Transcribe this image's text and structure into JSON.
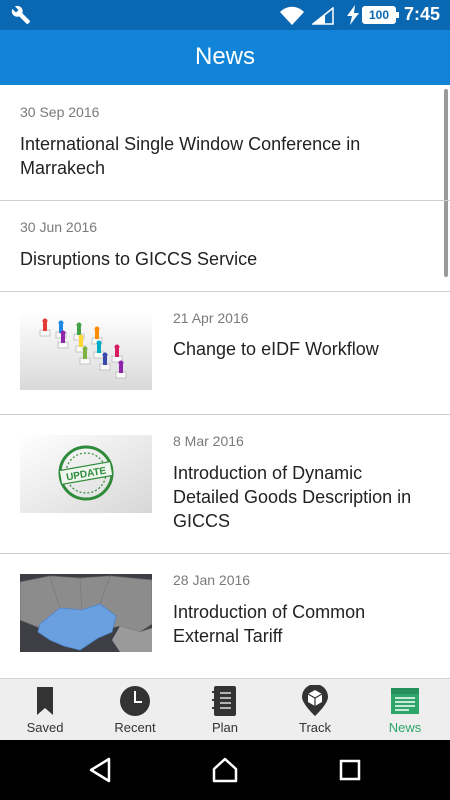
{
  "status_bar": {
    "battery_level": "100",
    "time": "7:45"
  },
  "header": {
    "title": "News"
  },
  "news_items": [
    {
      "date": "30 Sep 2016",
      "title": "International Single Window Conference in Marrakech"
    },
    {
      "date": "30 Jun 2016",
      "title": "Disruptions to GICCS Service"
    },
    {
      "date": "21 Apr 2016",
      "title": "Change to eIDF Workflow",
      "thumbnail": "people-network-image"
    },
    {
      "date": "8 Mar 2016",
      "title": "Introduction of Dynamic Detailed Goods Description in GICCS",
      "thumbnail": "update-stamp-image",
      "stamp_text": "UPDATE"
    },
    {
      "date": "28 Jan 2016",
      "title": "Introduction of Common External Tariff",
      "thumbnail": "west-africa-map-image"
    }
  ],
  "bottom_nav": {
    "items": [
      {
        "label": "Saved",
        "icon": "bookmark-icon"
      },
      {
        "label": "Recent",
        "icon": "clock-icon"
      },
      {
        "label": "Plan",
        "icon": "notebook-icon"
      },
      {
        "label": "Track",
        "icon": "location-box-icon"
      },
      {
        "label": "News",
        "icon": "newspaper-icon",
        "active": true
      }
    ]
  },
  "colors": {
    "status_bar": "#0a67b2",
    "app_bar": "#1184d7",
    "active_nav": "#2ea66a",
    "nav_background": "#eeeeee"
  }
}
